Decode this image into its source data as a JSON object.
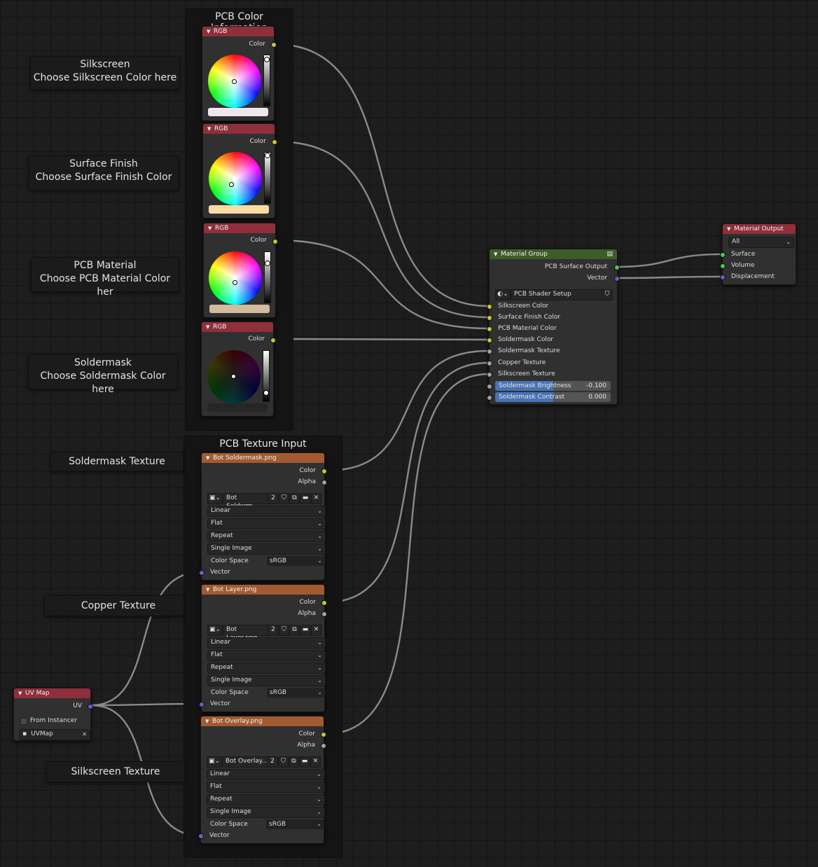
{
  "frames": {
    "color_info_title": "PCB Color Information",
    "texture_input_title": "PCB Texture Input"
  },
  "notes": {
    "silkscreen": {
      "line1": "Silkscreen",
      "line2": "Choose Silkscreen Color here"
    },
    "surface_finish": {
      "line1": "Surface Finish",
      "line2": "Choose Surface Finish Color"
    },
    "pcb_material": {
      "line1": "PCB Material",
      "line2": "Choose PCB Material Color her"
    },
    "soldermask": {
      "line1": "Soldermask",
      "line2": "Choose Soldermask Color here"
    },
    "soldermask_texture": "Soldermask Texture",
    "copper_texture": "Copper Texture",
    "silkscreen_texture": "Silkscreen Texture"
  },
  "rgb_nodes": [
    {
      "title": "RGB",
      "output": "Color",
      "swatch": "#eee6ec",
      "brightness": 0.97
    },
    {
      "title": "RGB",
      "output": "Color",
      "swatch": "#f7dca4",
      "brightness": 0.99
    },
    {
      "title": "RGB",
      "output": "Color",
      "swatch": "#d2bb9f",
      "brightness": 0.85
    },
    {
      "title": "RGB",
      "output": "Color",
      "swatch": "#262626",
      "brightness": 0.05
    }
  ],
  "image_nodes": [
    {
      "title": "Bot Soldermask.png",
      "image_name": "Bot Solderm...",
      "users": "2"
    },
    {
      "title": "Bot Layer.png",
      "image_name": "Bot Layer.png",
      "users": "2"
    },
    {
      "title": "Bot Overlay.png",
      "image_name": "Bot Overlay...",
      "users": "2"
    }
  ],
  "image_common": {
    "out_color": "Color",
    "out_alpha": "Alpha",
    "interpolation": "Linear",
    "projection": "Flat",
    "extension": "Repeat",
    "source": "Single Image",
    "color_space_label": "Color Space",
    "color_space": "sRGB",
    "in_vector": "Vector"
  },
  "material_group": {
    "title": "Material Group",
    "outputs": [
      "PCB Surface Output",
      "Vector"
    ],
    "group_name": "PCB Shader Setup",
    "inputs": [
      "Silkscreen Color",
      "Surface Finish Color",
      "PCB Material Color",
      "Soldermask Color",
      "Soldermask Texture",
      "Copper Texture",
      "Silkscreen Texture"
    ],
    "brightness": {
      "label": "Soldermask Brightness",
      "value": "-0.100",
      "fill": 0.5
    },
    "contrast": {
      "label": "Soldermask Contrast",
      "value": "0.000",
      "fill": 0.5
    }
  },
  "material_output": {
    "title": "Material Output",
    "target": "All",
    "inputs": [
      "Surface",
      "Volume",
      "Displacement"
    ]
  },
  "uv_map": {
    "title": "UV Map",
    "output": "UV",
    "from_instancer": "From Instancer",
    "uvmap": "UVMap"
  },
  "colors": {
    "rgb_header": "#8e2f3b",
    "image_header": "#a25a30",
    "group_header": "#3e5b2a",
    "socket_color": "#c7c729",
    "socket_vector": "#6363c7",
    "socket_shader": "#4dc74d",
    "field_fill": "#4772b3"
  }
}
